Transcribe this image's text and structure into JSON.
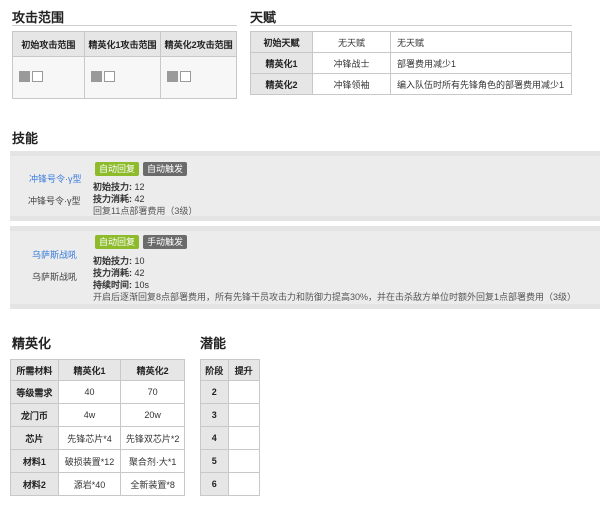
{
  "attack_range": {
    "title": "攻击范围",
    "headers": [
      "初始攻击范围",
      "精英化1攻击范围",
      "精英化2攻击范围"
    ]
  },
  "talent": {
    "title": "天赋",
    "rows": [
      {
        "stage": "初始天赋",
        "name": "无天赋",
        "effect": "无天赋"
      },
      {
        "stage": "精英化1",
        "name": "冲锋战士",
        "effect": "部署费用减少1"
      },
      {
        "stage": "精英化2",
        "name": "冲锋领袖",
        "effect": "编入队伍时所有先锋角色的部署费用减少1"
      }
    ]
  },
  "skills": {
    "title": "技能",
    "items": [
      {
        "link_name": "冲锋号令·γ型",
        "name": "冲锋号令·γ型",
        "badge1": "自动回复",
        "badge2": "自动触发",
        "init_label": "初始技力:",
        "init_value": "12",
        "cost_label": "技力消耗:",
        "cost_value": "42",
        "desc": "回复11点部署费用（3级）"
      },
      {
        "link_name": "乌萨斯战吼",
        "name": "乌萨斯战吼",
        "badge1": "自动回复",
        "badge2": "手动触发",
        "init_label": "初始技力:",
        "init_value": "10",
        "cost_label": "技力消耗:",
        "cost_value": "42",
        "dur_label": "持续时间:",
        "dur_value": "10s",
        "desc": "开启后逐渐回复8点部署费用，所有先锋干员攻击力和防御力提高30%，并在击杀敌方单位时额外回复1点部署费用（3级）"
      }
    ]
  },
  "elite": {
    "title": "精英化",
    "headers": [
      "所需材料",
      "精英化1",
      "精英化2"
    ],
    "rows": [
      {
        "label": "等级需求",
        "e1": "40",
        "e2": "70"
      },
      {
        "label": "龙门币",
        "e1": "4w",
        "e2": "20w"
      },
      {
        "label": "芯片",
        "e1": "先锋芯片*4",
        "e2": "先锋双芯片*2"
      },
      {
        "label": "材料1",
        "e1": "破损装置*12",
        "e2": "聚合剂·大*1"
      },
      {
        "label": "材料2",
        "e1": "源岩*40",
        "e2": "全新装置*8"
      }
    ]
  },
  "potential": {
    "title": "潜能",
    "headers": [
      "阶段",
      "提升"
    ],
    "rows": [
      "2",
      "3",
      "4",
      "5",
      "6"
    ]
  }
}
